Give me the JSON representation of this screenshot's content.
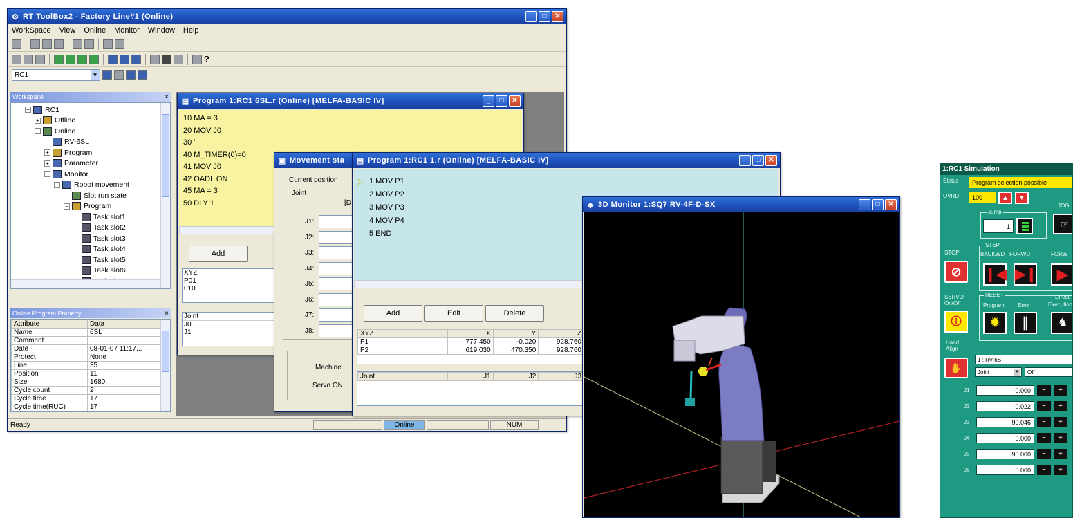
{
  "main_window": {
    "title": "RT ToolBox2 - Factory Line#1  (Online)",
    "menu": [
      "WorkSpace",
      "View",
      "Online",
      "Monitor",
      "Window",
      "Help"
    ],
    "controller_select": "RC1",
    "workspace_panel_title": "Workspace",
    "tree": [
      {
        "label": "RC1",
        "level": 1,
        "expander": "−"
      },
      {
        "label": "Offline",
        "level": 2,
        "expander": "+"
      },
      {
        "label": "Online",
        "level": 2,
        "expander": "−"
      },
      {
        "label": "RV-6SL",
        "level": 3,
        "expander": ""
      },
      {
        "label": "Program",
        "level": 3,
        "expander": "+"
      },
      {
        "label": "Parameter",
        "level": 3,
        "expander": "+"
      },
      {
        "label": "Monitor",
        "level": 3,
        "expander": "−"
      },
      {
        "label": "Robot movement",
        "level": 4,
        "expander": "−"
      },
      {
        "label": "Slot run state",
        "level": 5,
        "expander": ""
      },
      {
        "label": "Program",
        "level": 5,
        "expander": "−"
      },
      {
        "label": "Task slot1",
        "level": 6,
        "expander": ""
      },
      {
        "label": "Task slot2",
        "level": 6,
        "expander": ""
      },
      {
        "label": "Task slot3",
        "level": 6,
        "expander": ""
      },
      {
        "label": "Task slot4",
        "level": 6,
        "expander": ""
      },
      {
        "label": "Task slot5",
        "level": 6,
        "expander": ""
      },
      {
        "label": "Task slot6",
        "level": 6,
        "expander": ""
      },
      {
        "label": "Task slot7",
        "level": 6,
        "expander": ""
      }
    ],
    "property_panel_title": "Online Program Property",
    "property_headers": [
      "Attribute",
      "Data"
    ],
    "properties": [
      [
        "Name",
        "6SL"
      ],
      [
        "Comment",
        ""
      ],
      [
        "Date",
        "08-01-07 11:17..."
      ],
      [
        "Protect",
        "None"
      ],
      [
        "Line",
        "35"
      ],
      [
        "Position",
        "11"
      ],
      [
        "Size",
        "1680"
      ],
      [
        "Cycle count",
        "2"
      ],
      [
        "Cycle time",
        "17"
      ],
      [
        "Cycle time(RUC)",
        "17"
      ]
    ],
    "status_ready": "Ready",
    "status_online": "Online",
    "status_num": "NUM"
  },
  "program_6sl": {
    "title": "Program 1:RC1 6SL.r (Online)   [MELFA-BASIC IV]",
    "lines": [
      "10 MA = 3",
      "20 MOV J0",
      "30 '",
      "40 M_TIMER(0)=0",
      "41 MOV J0",
      "42 OADL ON",
      "45 MA = 3",
      "50 DLY 1"
    ],
    "add_label": "Add",
    "xyz_header": "XYZ",
    "xyz_rows": [
      "P01",
      "010"
    ],
    "joint_header": "Joint",
    "joint_rows": [
      "J0",
      "J1"
    ]
  },
  "movement_state": {
    "title": "Movement sta",
    "group_label": "Current position",
    "joint_label": "Joint",
    "bracket_text": "[D",
    "axes": [
      "J1:",
      "J2:",
      "J3:",
      "J4:",
      "J5:",
      "J6:",
      "J7:",
      "J8:"
    ],
    "machine_label": "Machine",
    "servo_label": "Servo ON"
  },
  "program_1": {
    "title": "Program 1:RC1 1.r (Online)   [MELFA-BASIC IV]",
    "lines": [
      "1 MOV P1",
      "2 MOV P2",
      "3 MOV P3",
      "4 MOV P4",
      "5 END"
    ],
    "buttons": {
      "add": "Add",
      "edit": "Edit",
      "delete": "Delete"
    },
    "xyz_headers": [
      "XYZ",
      "X",
      "Y",
      "Z"
    ],
    "xyz_rows": [
      [
        "P1",
        "777.450",
        "-0.020",
        "928.760"
      ],
      [
        "P2",
        "619.030",
        "470.350",
        "928.760"
      ]
    ],
    "joint_headers": [
      "Joint",
      "J1",
      "J2",
      "J3"
    ]
  },
  "monitor_3d": {
    "title": "3D Monitor 1:SQ7 RV-4F-D-SX"
  },
  "simulation": {
    "title": "1:RC1  Simulation",
    "status_label": "Status",
    "status_value": "Program selection possible",
    "ovrd_label": "OVRD",
    "ovrd_value": "100",
    "jump_label": "Jump",
    "jump_value": "1",
    "jog_label": "JOG",
    "stop_label": "STOP",
    "step_label": "STEP",
    "backwd_label": "BACKWD",
    "forwd_label": "FORWD",
    "forwd2_label": "FORW",
    "servo_label": "SERVO On/Off",
    "reset_label": "RESET",
    "program_label": "Program",
    "error_label": "Error",
    "direct_label": "Direct",
    "execution_label": "Execution",
    "hand_label": "Hand Align",
    "robot_select": "1 : RV-6S",
    "mode_select": "Joint",
    "off_select": "Off",
    "joints": [
      {
        "label": "J1",
        "value": "0.000"
      },
      {
        "label": "J2",
        "value": "0.022"
      },
      {
        "label": "J3",
        "value": "90.046"
      },
      {
        "label": "J4",
        "value": "0.000"
      },
      {
        "label": "J5",
        "value": "90.000"
      },
      {
        "label": "J6",
        "value": "0.000"
      }
    ],
    "minus": "−",
    "plus": "+"
  }
}
